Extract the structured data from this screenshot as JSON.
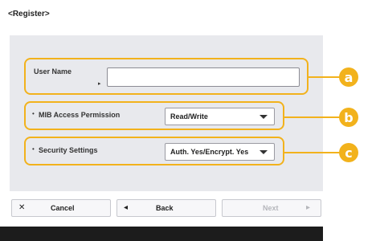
{
  "screen": {
    "title": "<Register>"
  },
  "form": {
    "user_name_label": "User Name",
    "user_name_value": "",
    "mib_label": "MIB Access Permission",
    "mib_value": "Read/Write",
    "security_label": "Security Settings",
    "security_value": "Auth. Yes/Encrypt. Yes"
  },
  "callouts": {
    "a": "a",
    "b": "b",
    "c": "c"
  },
  "buttons": {
    "cancel_label": "Cancel",
    "back_label": "Back",
    "next_label": "Next"
  },
  "colors": {
    "callout": "#f2b21c",
    "panel": "#e8e9ed",
    "bottom_bar": "#1c1c1c"
  },
  "icons": {
    "cancel": "close-icon",
    "back": "arrow-left-icon",
    "next": "arrow-right-icon",
    "dropdown": "chevron-down-icon"
  }
}
